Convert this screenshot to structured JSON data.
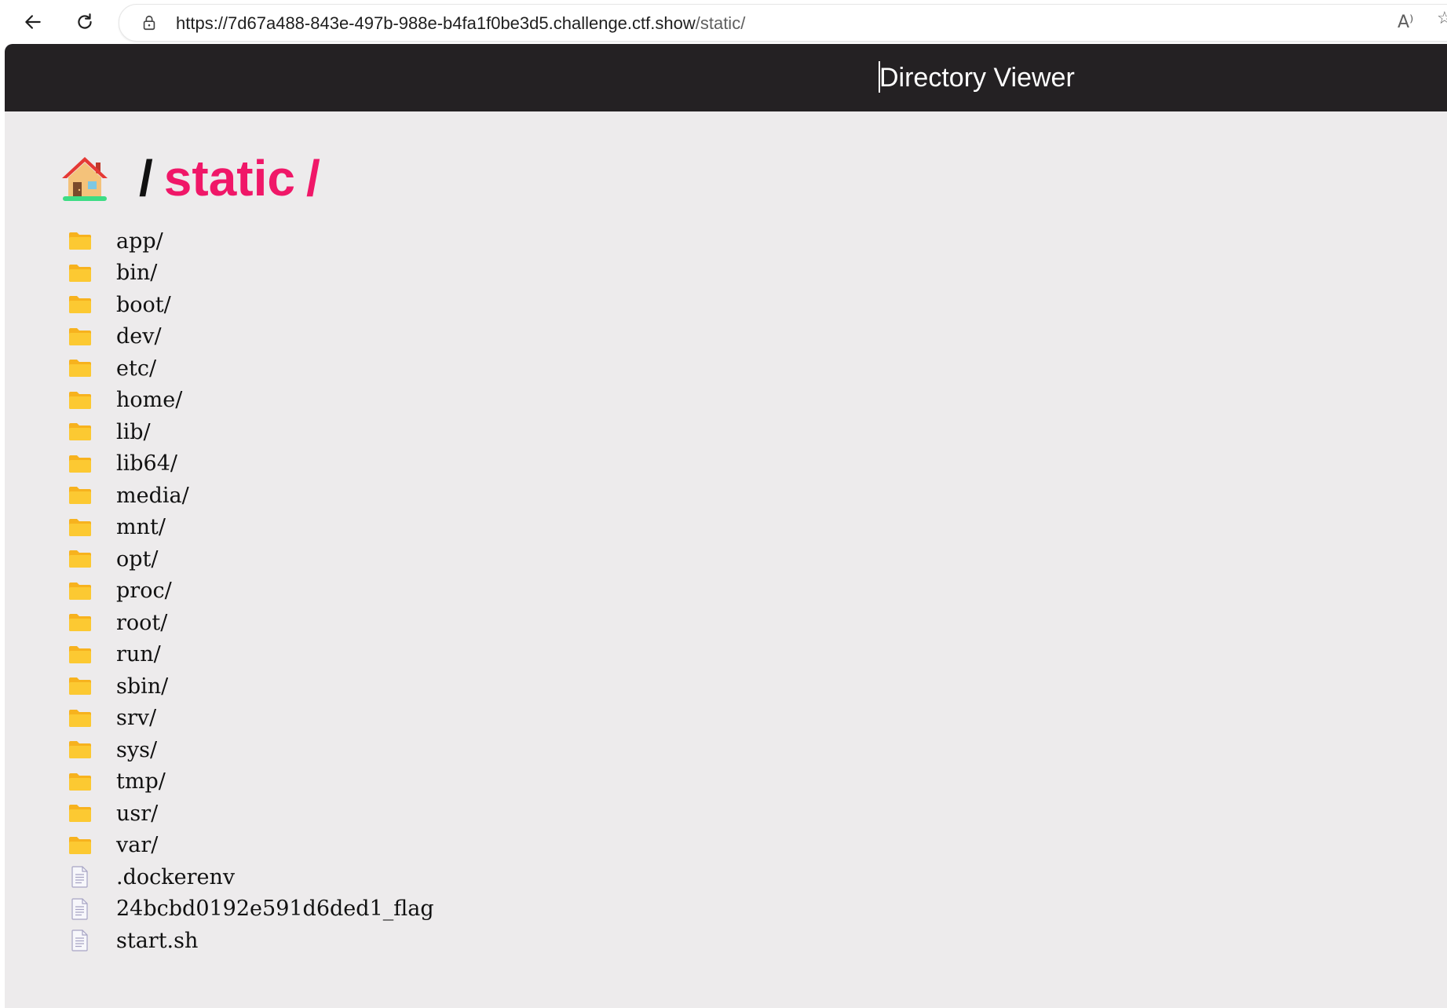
{
  "browser": {
    "url_main": "https://7d67a488-843e-497b-988e-b4fa1f0be3d5.challenge.ctf.show",
    "url_path": "/static/",
    "icons": {
      "back": "back-arrow-icon",
      "reload": "reload-icon",
      "lock": "lock-icon",
      "read_aloud": "read-aloud-icon"
    },
    "read_aloud_glyph": "A⁾"
  },
  "app": {
    "title": "Directory Viewer"
  },
  "breadcrumb": {
    "home_icon": "house-emoji-icon",
    "separator": "/",
    "current_dir": "static",
    "trailing_slash": "/"
  },
  "colors": {
    "header_bg": "#242123",
    "page_bg": "#edebec",
    "accent": "#f01768",
    "folder": "#fcc932"
  },
  "entries": [
    {
      "name": "app/",
      "type": "folder"
    },
    {
      "name": "bin/",
      "type": "folder"
    },
    {
      "name": "boot/",
      "type": "folder"
    },
    {
      "name": "dev/",
      "type": "folder"
    },
    {
      "name": "etc/",
      "type": "folder"
    },
    {
      "name": "home/",
      "type": "folder"
    },
    {
      "name": "lib/",
      "type": "folder"
    },
    {
      "name": "lib64/",
      "type": "folder"
    },
    {
      "name": "media/",
      "type": "folder"
    },
    {
      "name": "mnt/",
      "type": "folder"
    },
    {
      "name": "opt/",
      "type": "folder"
    },
    {
      "name": "proc/",
      "type": "folder"
    },
    {
      "name": "root/",
      "type": "folder"
    },
    {
      "name": "run/",
      "type": "folder"
    },
    {
      "name": "sbin/",
      "type": "folder"
    },
    {
      "name": "srv/",
      "type": "folder"
    },
    {
      "name": "sys/",
      "type": "folder"
    },
    {
      "name": "tmp/",
      "type": "folder"
    },
    {
      "name": "usr/",
      "type": "folder"
    },
    {
      "name": "var/",
      "type": "folder"
    },
    {
      "name": ".dockerenv",
      "type": "file"
    },
    {
      "name": "24bcbd0192e591d6ded1_flag",
      "type": "file"
    },
    {
      "name": "start.sh",
      "type": "file"
    }
  ]
}
